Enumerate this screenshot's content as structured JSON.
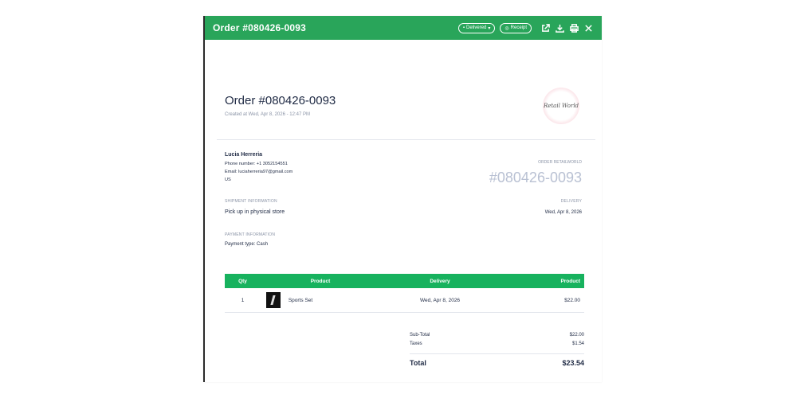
{
  "header": {
    "title": "Order #080426-0093",
    "status_pill": "Delivered",
    "receipt_pill": "Receipt"
  },
  "order": {
    "heading": "Order #080426-0093",
    "created": "Created at Wed, Apr 8, 2026 - 12:47 PM",
    "logo_text": "Retail World"
  },
  "customer": {
    "name": "Lucia Herreria",
    "phone": "Phone number: +1 3052154551",
    "email": "Email: luciaherreria97@gmail.com",
    "country": "US"
  },
  "order_ref": {
    "label": "ORDER RETAILWORLD",
    "number": "#080426-0093"
  },
  "shipment": {
    "label": "SHIPMENT INFORMATION",
    "value": "Pick up in physical store"
  },
  "delivery": {
    "label": "DELIVERY",
    "value": "Wed, Apr 8, 2026"
  },
  "payment": {
    "label": "PAYMENT INFORMATION",
    "value": "Payment type: Cash"
  },
  "table": {
    "headers": {
      "qty": "Qty",
      "product": "Product",
      "delivery": "Delivery",
      "price": "Product"
    },
    "rows": [
      {
        "qty": "1",
        "product": "Sports Set",
        "delivery": "Wed, Apr 8, 2026",
        "price": "$22.00"
      }
    ]
  },
  "totals": {
    "subtotal_label": "Sub-Total",
    "subtotal_value": "$22.00",
    "taxes_label": "Taxes",
    "taxes_value": "$1.54",
    "total_label": "Total",
    "total_value": "$23.54"
  },
  "colors": {
    "accent": "#29a55a",
    "table_header": "#17b25e",
    "muted": "#8a93a6"
  }
}
